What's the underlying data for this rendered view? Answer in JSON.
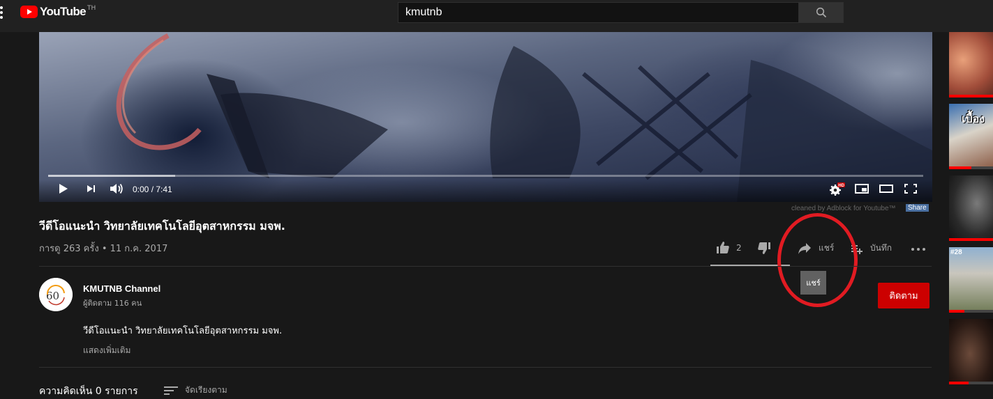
{
  "header": {
    "logo_text": "YouTube",
    "country_code": "TH",
    "search_value": "kmutnb"
  },
  "player": {
    "time_display": "0:00 / 7:41",
    "progress_fraction": 0.0,
    "buffer_fraction": 0.145
  },
  "adblock": {
    "note": "cleaned by Adblock for Youtube™",
    "share_label": "Share"
  },
  "video": {
    "title": "วีดีโอแนะนำ วิทยาลัยเทคโนโลยีอุตสาหกรรม มจพ.",
    "view_info": "การดู 263 ครั้ง • 11 ก.ค. 2017"
  },
  "actions": {
    "like_count": "2",
    "share_label": "แชร์",
    "save_label": "บันทึก",
    "tooltip": "แชร์"
  },
  "channel": {
    "name": "KMUTNB Channel",
    "subscribers": "ผู้ติดตาม 116 คน",
    "subscribe_label": "ติดตาม"
  },
  "description": {
    "text": "วีดีโอแนะนำ วิทยาลัยเทคโนโลยีอุตสาหกรรม มจพ.",
    "show_more": "แสดงเพิ่มเติม"
  },
  "comments": {
    "count_label": "ความคิดเห็น 0 รายการ",
    "sort_label": "จัดเรียงตาม"
  },
  "sidebar": {
    "thumbnails": [
      {
        "badge": "",
        "text": "",
        "progress": 1.0
      },
      {
        "badge": "",
        "text": "เบื้อง",
        "progress": 0.5
      },
      {
        "badge": "",
        "text": "",
        "progress": 1.0
      },
      {
        "badge": "#28",
        "text": "",
        "progress": 0.35
      },
      {
        "badge": "",
        "text": "",
        "progress": 0.45
      }
    ]
  },
  "colors": {
    "background": "#181818",
    "topbar": "#212121",
    "brand_red": "#ff0000",
    "subscribe_red": "#cc0000",
    "annotation_red": "#e11b22"
  }
}
